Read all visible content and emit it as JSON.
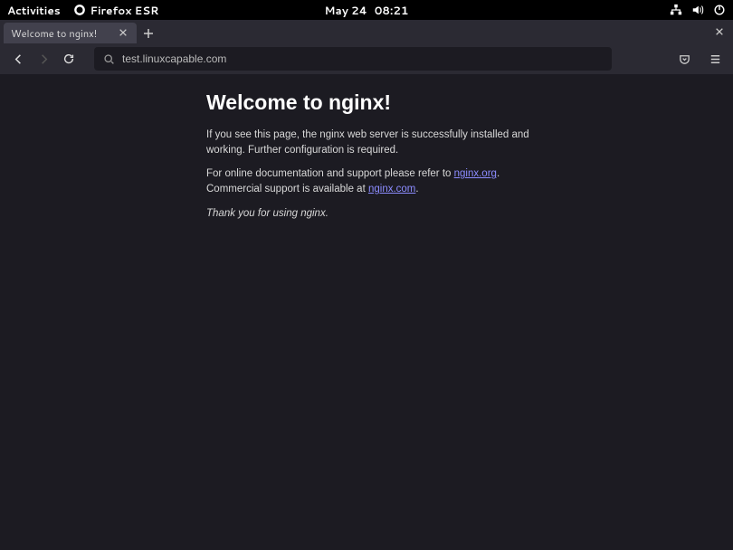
{
  "topbar": {
    "activities": "Activities",
    "app_name": "Firefox ESR",
    "date": "May 24",
    "time": "08:21"
  },
  "tabs": [
    {
      "title": "Welcome to nginx!"
    }
  ],
  "urlbar": {
    "value": "test.linuxcapable.com"
  },
  "page": {
    "heading": "Welcome to nginx!",
    "p1": "If you see this page, the nginx web server is successfully installed and working. Further configuration is required.",
    "p2_a": "For online documentation and support please refer to ",
    "p2_link1": "nginx.org",
    "p2_b": ".",
    "p2_c": "Commercial support is available at ",
    "p2_link2": "nginx.com",
    "p2_d": ".",
    "p3": "Thank you for using nginx."
  }
}
